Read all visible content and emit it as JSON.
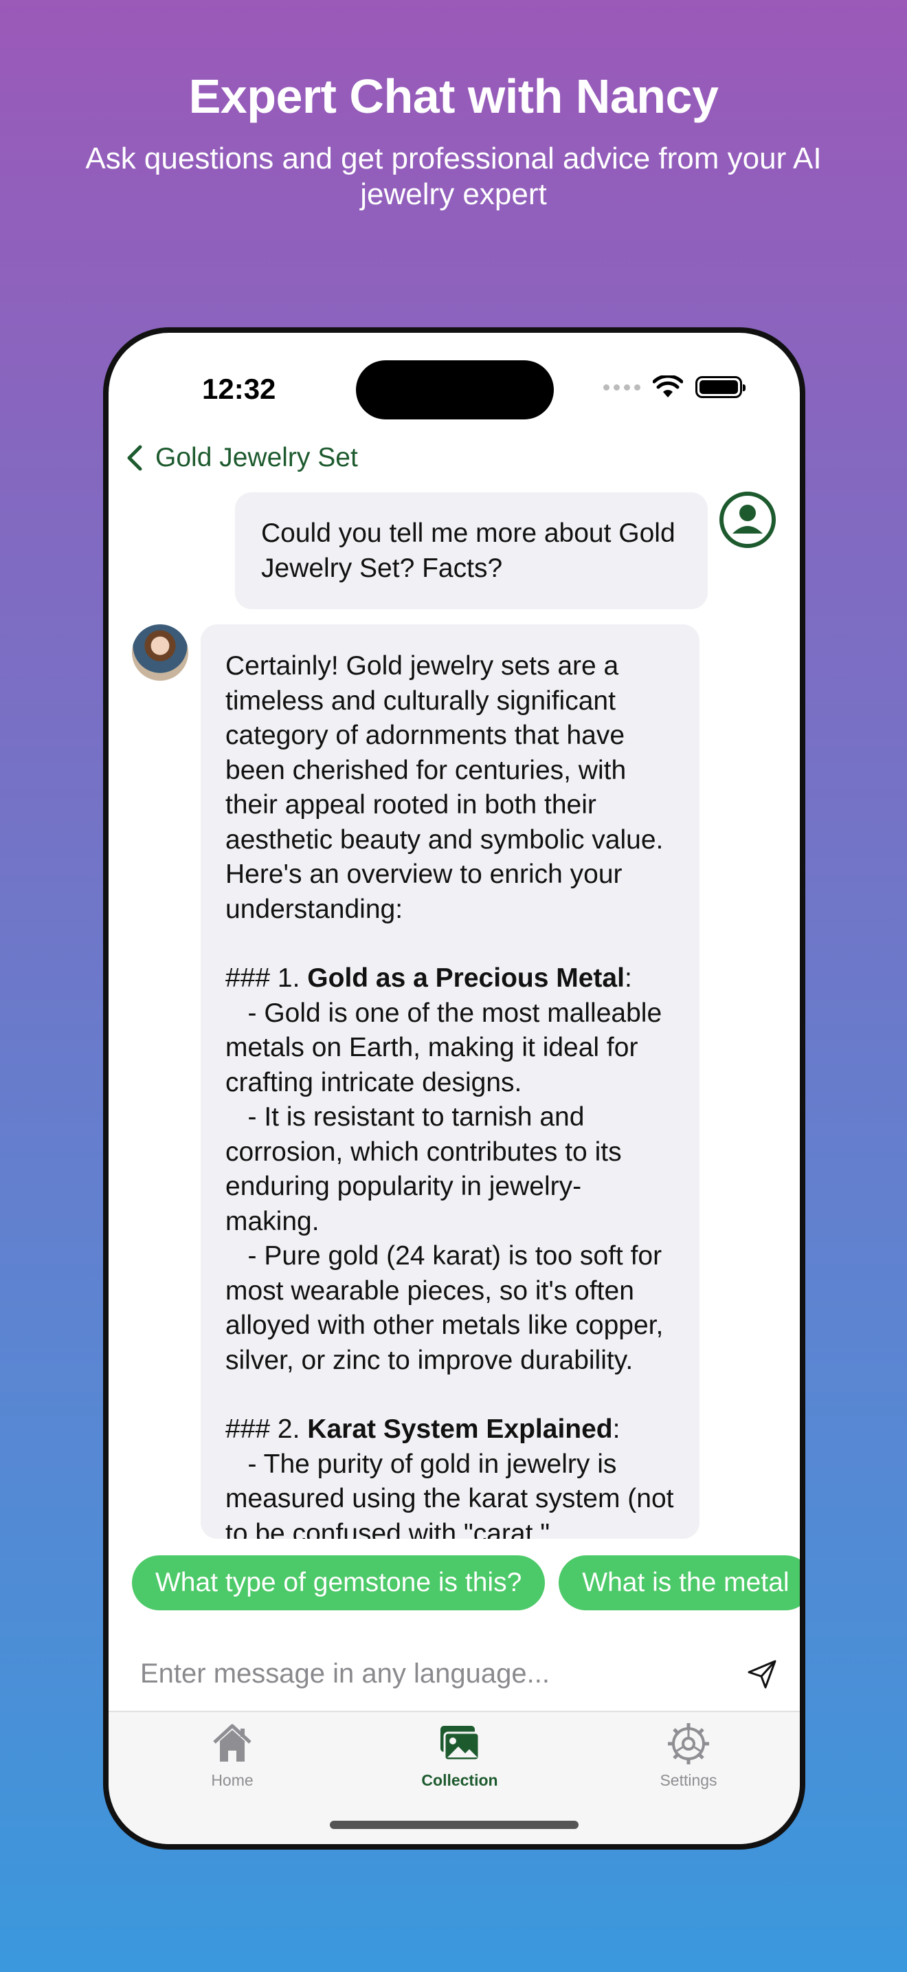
{
  "promo": {
    "title": "Expert Chat with Nancy",
    "subtitle": "Ask questions and get professional advice from your AI jewelry expert"
  },
  "status_bar": {
    "time": "12:32"
  },
  "nav": {
    "title": "Gold Jewelry Set"
  },
  "messages": {
    "user": "Could you tell me more about Gold Jewelry Set? Facts?",
    "bot": {
      "intro": "Certainly! Gold jewelry sets are a timeless and culturally significant category of adornments that have been cherished for centuries, with their appeal rooted in both their aesthetic beauty and symbolic value. Here's an overview to enrich your understanding:",
      "s1_prefix": "### 1. ",
      "s1_title": "Gold as a Precious Metal",
      "s1_colon": ":",
      "s1_body": "   - Gold is one of the most malleable metals on Earth, making it ideal for crafting intricate designs.\n   - It is resistant to tarnish and corrosion, which contributes to its enduring popularity in jewelry-making.\n   - Pure gold (24 karat) is too soft for most wearable pieces, so it's often alloyed with other metals like copper, silver, or zinc to improve durability.",
      "s2_prefix": "### 2. ",
      "s2_title": "Karat System Explained",
      "s2_colon": ":",
      "s2_body": "   - The purity of gold in jewelry is measured using the karat system (not to be confused with \"carat,\""
    }
  },
  "suggestions": [
    "What type of gemstone is this?",
    "What is the metal"
  ],
  "input": {
    "placeholder": "Enter message in any language..."
  },
  "tabs": [
    {
      "label": "Home",
      "icon": "house-icon",
      "active": false
    },
    {
      "label": "Collection",
      "icon": "photos-icon",
      "active": true
    },
    {
      "label": "Settings",
      "icon": "gear-icon",
      "active": false
    }
  ],
  "colors": {
    "accent": "#1d5a2e",
    "chip": "#4cc968",
    "bubble": "#f1f1f5"
  }
}
